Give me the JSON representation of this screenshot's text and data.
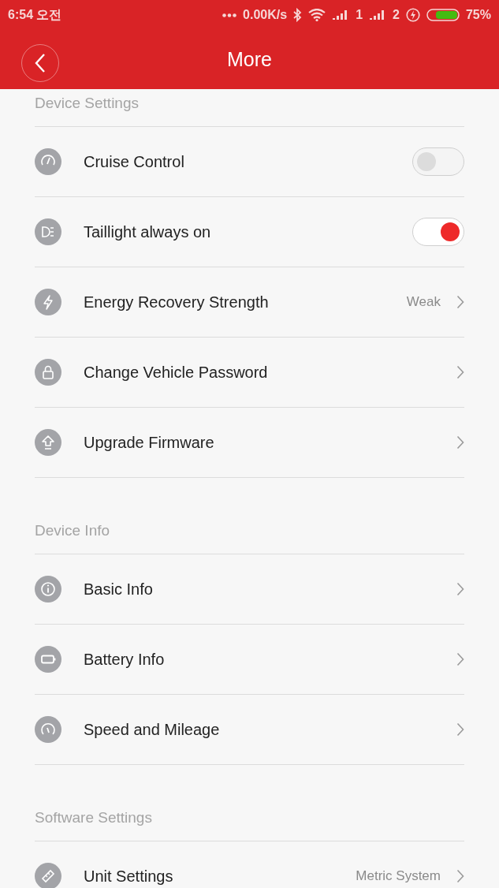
{
  "status_bar": {
    "time": "6:54 오전",
    "network_speed": "0.00K/s",
    "sim_1": "1",
    "sim_2": "2",
    "battery": "75%"
  },
  "header": {
    "title": "More"
  },
  "sections": [
    {
      "title": "Device Settings",
      "items": [
        {
          "kind": "toggle",
          "label": "Cruise Control",
          "on": false
        },
        {
          "kind": "toggle",
          "label": "Taillight always on",
          "on": true
        },
        {
          "kind": "link",
          "label": "Energy Recovery Strength",
          "value": "Weak"
        },
        {
          "kind": "link",
          "label": "Change Vehicle Password"
        },
        {
          "kind": "link",
          "label": "Upgrade Firmware"
        }
      ]
    },
    {
      "title": "Device Info",
      "items": [
        {
          "kind": "link",
          "label": "Basic Info"
        },
        {
          "kind": "link",
          "label": "Battery Info"
        },
        {
          "kind": "link",
          "label": "Speed and Mileage"
        }
      ]
    },
    {
      "title": "Software Settings",
      "items": [
        {
          "kind": "link",
          "label": "Unit Settings",
          "value": "Metric System"
        }
      ]
    }
  ]
}
